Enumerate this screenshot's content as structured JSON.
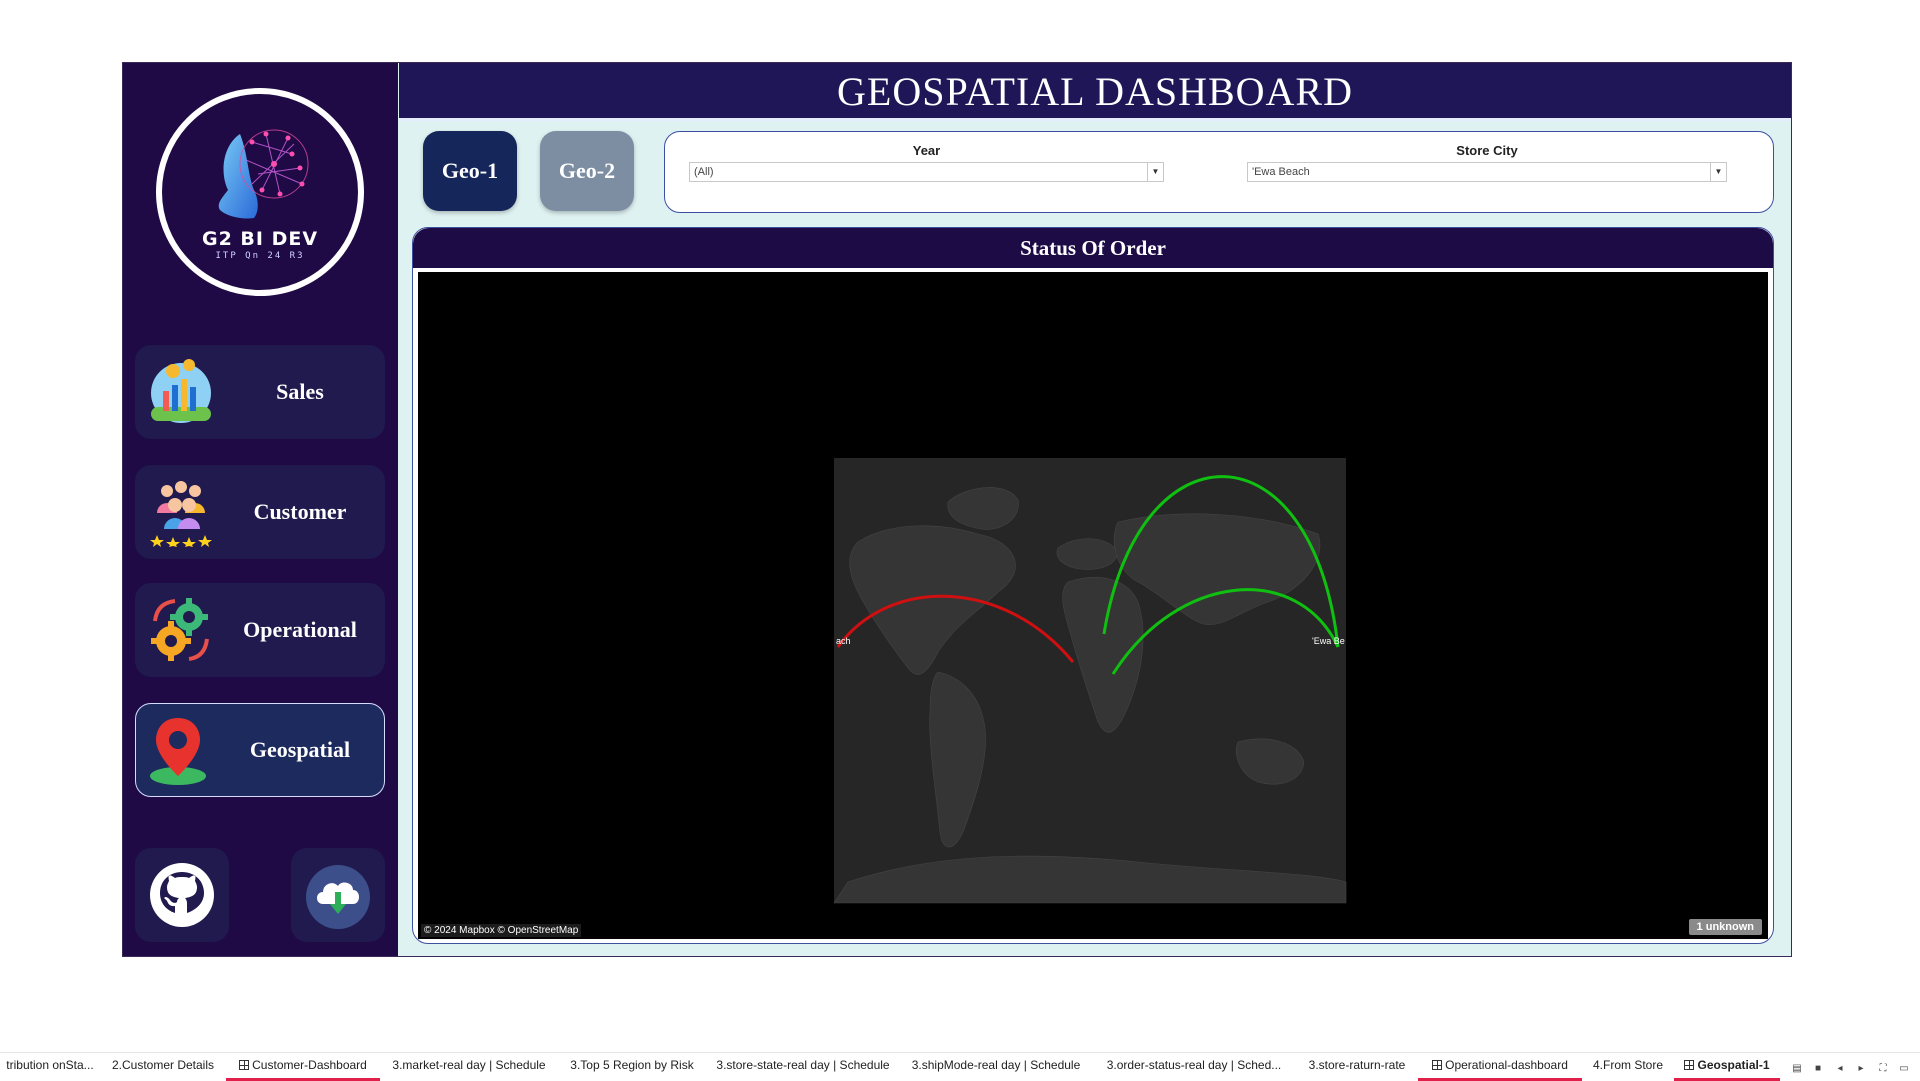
{
  "dashboard": {
    "title": "GEOSPATIAL DASHBOARD"
  },
  "logo": {
    "text": "G2 BI DEV",
    "subtext": "ITP Qn 24 R3"
  },
  "sidebar": {
    "items": [
      {
        "label": "Sales",
        "icon": "sales-chart-icon",
        "active": false
      },
      {
        "label": "Customer",
        "icon": "customer-group-icon",
        "active": false
      },
      {
        "label": "Operational",
        "icon": "gears-icon",
        "active": false
      },
      {
        "label": "Geospatial",
        "icon": "map-pin-icon",
        "active": true
      }
    ],
    "github_icon": "github-icon",
    "download_icon": "cloud-download-icon"
  },
  "geo_buttons": {
    "geo1": "Geo-1",
    "geo2": "Geo-2"
  },
  "filters": {
    "year": {
      "label": "Year",
      "value": "(All)"
    },
    "store_city": {
      "label": "Store City",
      "value": "'Ewa Beach"
    }
  },
  "map": {
    "title": "Status Of Order",
    "attribution": "© 2024 Mapbox © OpenStreetMap",
    "unknown_badge": "1 unknown",
    "left_label": "ach",
    "right_label": "'Ewa Be",
    "colors": {
      "late": "#d01010",
      "on_time": "#10c010",
      "land": "#333333",
      "ocean": "#262626"
    }
  },
  "tabs": [
    {
      "label": "tribution onSta...",
      "dashboard": false,
      "active": false
    },
    {
      "label": "2.Customer Details",
      "dashboard": false,
      "active": false
    },
    {
      "label": "Customer-Dashboard",
      "dashboard": true,
      "active": false
    },
    {
      "label": "3.market-real day | Schedule",
      "dashboard": false,
      "active": false
    },
    {
      "label": "3.Top 5 Region by Risk",
      "dashboard": false,
      "active": false
    },
    {
      "label": "3.store-state-real day | Schedule",
      "dashboard": false,
      "active": false
    },
    {
      "label": "3.shipMode-real day | Schedule",
      "dashboard": false,
      "active": false
    },
    {
      "label": "3.order-status-real day | Sched...",
      "dashboard": false,
      "active": false
    },
    {
      "label": "3.store-raturn-rate",
      "dashboard": false,
      "active": false
    },
    {
      "label": "Operational-dashboard",
      "dashboard": true,
      "active": false
    },
    {
      "label": "4.From Store",
      "dashboard": false,
      "active": false
    },
    {
      "label": "Geospatial-1",
      "dashboard": true,
      "active": true
    }
  ]
}
